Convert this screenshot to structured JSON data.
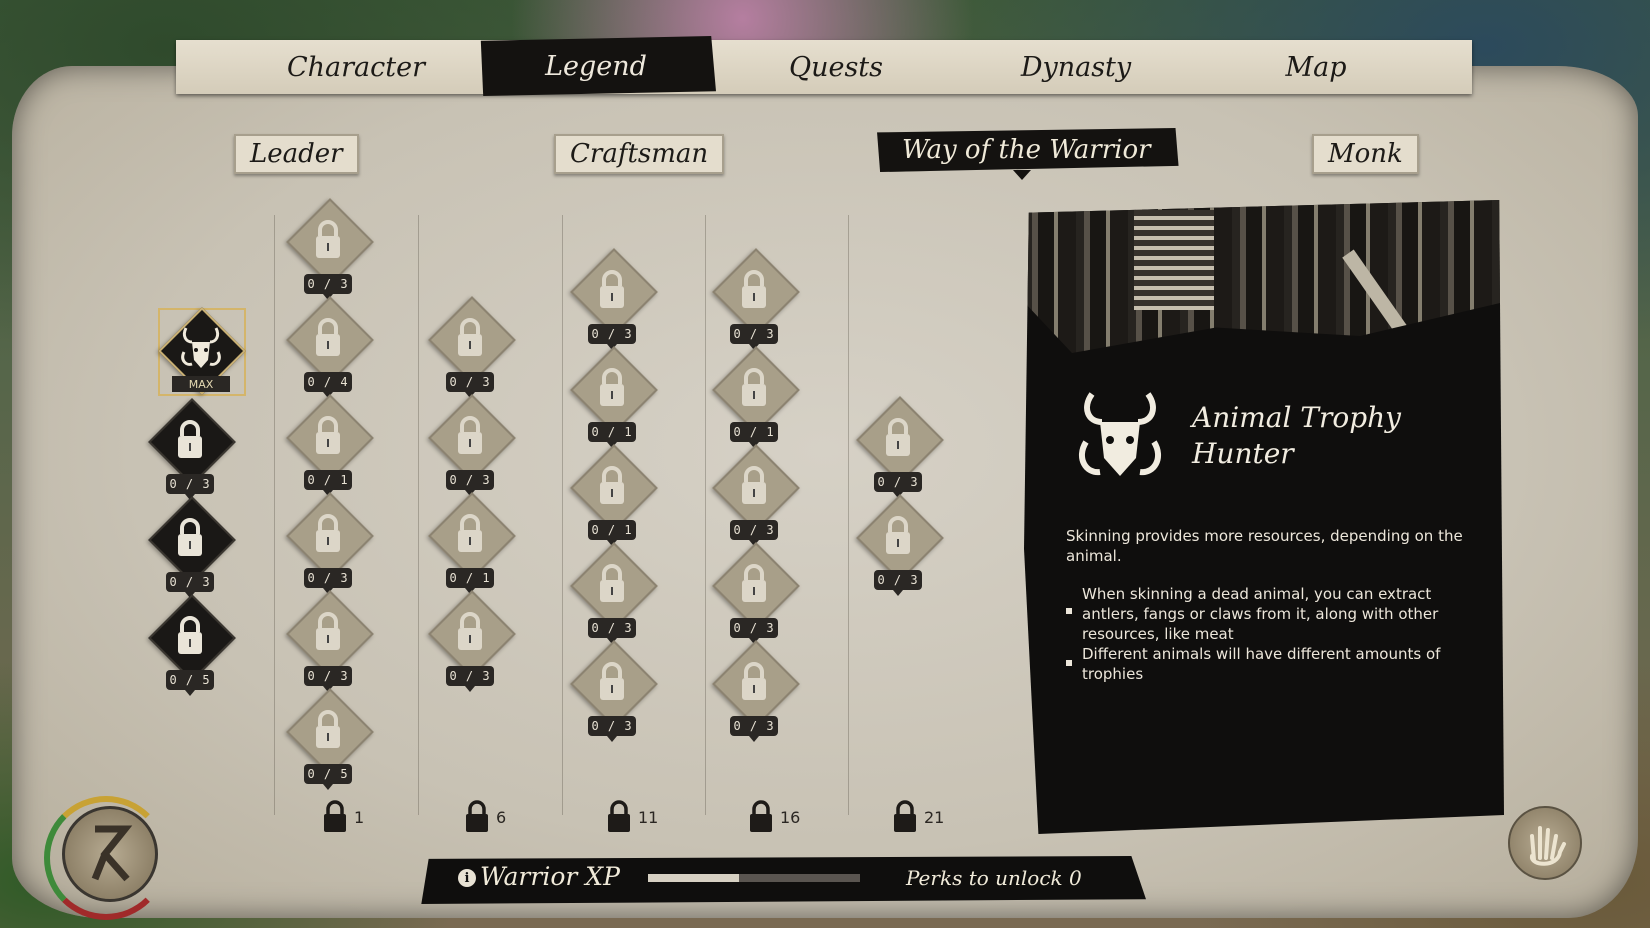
{
  "top_tabs": [
    {
      "label": "Character"
    },
    {
      "label": "Legend"
    },
    {
      "label": "Quests"
    },
    {
      "label": "Dynasty"
    },
    {
      "label": "Map"
    }
  ],
  "active_top_tab": "Legend",
  "sub_tabs": [
    {
      "label": "Leader"
    },
    {
      "label": "Craftsman"
    },
    {
      "label": "Way of the Warrior"
    },
    {
      "label": "Monk"
    }
  ],
  "active_sub_tab": "Way of the Warrior",
  "skill_tree": {
    "max_label": "MAX",
    "columns": [
      {
        "nodes": [
          "0 / 3",
          "0 / 3",
          "0 / 5"
        ]
      },
      {
        "nodes": [
          "0 / 3",
          "0 / 4",
          "0 / 1",
          "0 / 3",
          "0 / 3",
          "0 / 5"
        ],
        "unlock_level": "1"
      },
      {
        "nodes": [
          "0 / 3",
          "0 / 3",
          "0 / 1",
          "0 / 3"
        ],
        "unlock_level": "6"
      },
      {
        "nodes": [
          "0 / 3",
          "0 / 1",
          "0 / 1",
          "0 / 3",
          "0 / 3"
        ],
        "unlock_level": "11"
      },
      {
        "nodes": [
          "0 / 3",
          "0 / 1",
          "0 / 3",
          "0 / 3",
          "0 / 3"
        ],
        "unlock_level": "16"
      },
      {
        "nodes": [
          "0 / 3",
          "0 / 3"
        ],
        "unlock_level": "21"
      }
    ]
  },
  "perk": {
    "icon": "animal-trophy-icon",
    "title_line1": "Animal Trophy",
    "title_line2": "Hunter",
    "description": "Skinning provides more resources, depending on the animal.",
    "bullets": [
      "When skinning a dead animal, you can extract antlers, fangs or claws from it, along with other resources, like meat",
      "Different animals will have different amounts of trophies"
    ]
  },
  "xp": {
    "info_icon": "i",
    "label": "Warrior XP",
    "progress": 0.43,
    "perks_label": "Perks to unlock",
    "perks_value": "0"
  },
  "icons": {
    "lock": "lock-icon",
    "emblem": "rune-emblem-icon",
    "hand": "hand-icon"
  }
}
